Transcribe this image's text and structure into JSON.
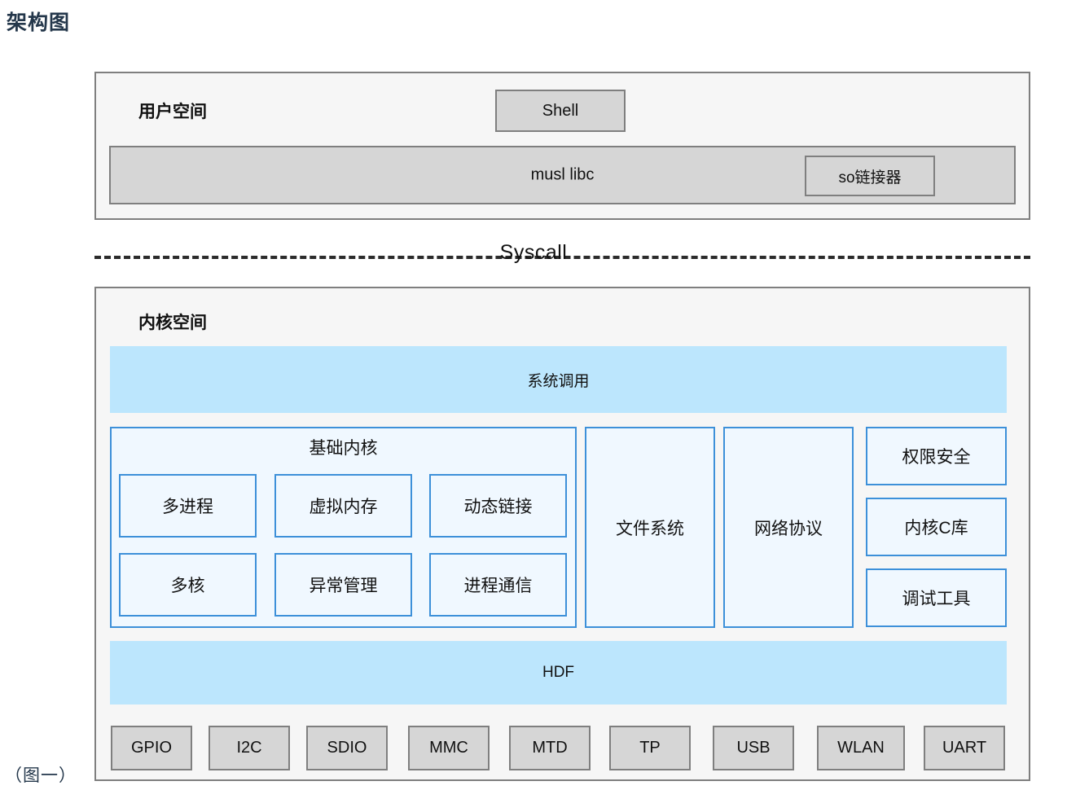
{
  "page": {
    "title": "架构图",
    "caption": "（图一）"
  },
  "colors": {
    "frame_border": "#7f7f7f",
    "frame_fill": "#f6f6f6",
    "gray_fill": "#d6d6d6",
    "blue_bar_fill": "#bce6fd",
    "blue_box_fill": "#f0f8ff",
    "blue_border": "#3d90d9",
    "title_color": "#24374b"
  },
  "user_space": {
    "label": "用户空间",
    "shell": "Shell",
    "libc": "musl libc",
    "linker": "so链接器"
  },
  "divider": {
    "label": "Syscall",
    "style": "dashed"
  },
  "kernel_space": {
    "label": "内核空间",
    "syscall_bar": "系统调用",
    "hdf_bar": "HDF",
    "core_kernel": {
      "title": "基础内核",
      "modules": [
        "多进程",
        "虚拟内存",
        "动态链接",
        "多核",
        "异常管理",
        "进程通信"
      ]
    },
    "subsystems": [
      "文件系统",
      "网络协议"
    ],
    "right_column": [
      "权限安全",
      "内核C库",
      "调试工具"
    ],
    "drivers": [
      "GPIO",
      "I2C",
      "SDIO",
      "MMC",
      "MTD",
      "TP",
      "USB",
      "WLAN",
      "UART"
    ]
  }
}
